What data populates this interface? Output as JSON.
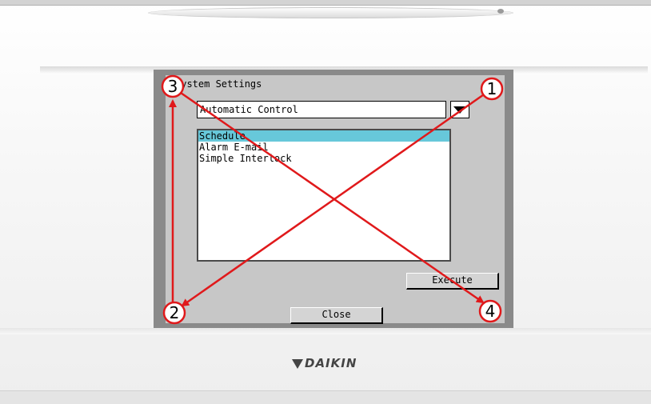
{
  "screen": {
    "title": "System Settings",
    "category_dropdown": {
      "selected": "Automatic Control"
    },
    "list_items": [
      {
        "label": "Schedule",
        "selected": true
      },
      {
        "label": "Alarm E-mail",
        "selected": false
      },
      {
        "label": "Simple Interlock",
        "selected": false
      }
    ],
    "execute_label": "Execute",
    "close_label": "Close",
    "selection_color": "#67c8da"
  },
  "brand": {
    "logo_text": "DAIKIN"
  },
  "annotations": {
    "color": "#e0191b",
    "markers": [
      "1",
      "2",
      "3",
      "4"
    ]
  }
}
